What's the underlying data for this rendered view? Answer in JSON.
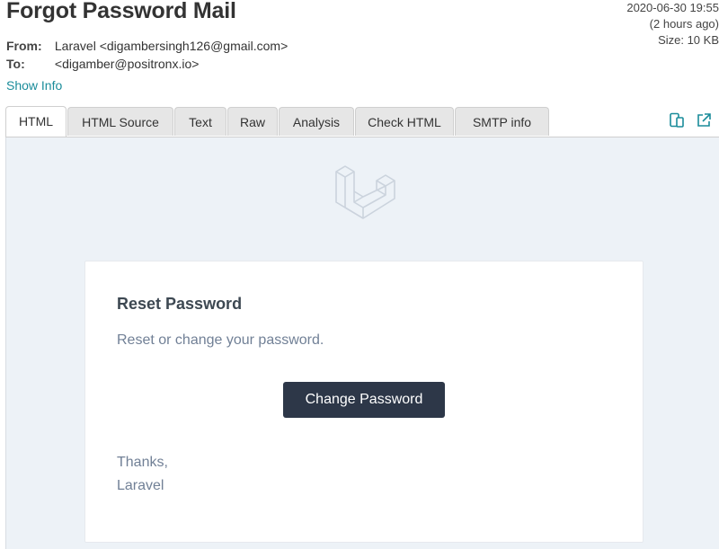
{
  "email": {
    "subject": "Forgot Password Mail",
    "date": "2020-06-30 19:55",
    "relative_time": "(2 hours ago)",
    "size_label": "Size: 10 KB",
    "from_label": "From:",
    "from_value": "Laravel <digambersingh126@gmail.com>",
    "to_label": "To:",
    "to_value": "<digamber@positronx.io>",
    "show_info": "Show Info"
  },
  "tabs": [
    {
      "label": "HTML",
      "active": true
    },
    {
      "label": "HTML Source",
      "active": false
    },
    {
      "label": "Text",
      "active": false
    },
    {
      "label": "Raw",
      "active": false
    },
    {
      "label": "Analysis",
      "active": false
    },
    {
      "label": "Check HTML",
      "active": false
    },
    {
      "label": "SMTP info",
      "active": false
    }
  ],
  "toolbar_icons": [
    "mobile-view-icon",
    "open-external-icon"
  ],
  "message": {
    "title": "Reset Password",
    "body": "Reset or change your password.",
    "button_label": "Change Password",
    "signoff_line1": "Thanks,",
    "signoff_line2": "Laravel"
  },
  "colors": {
    "accent": "#1a8c9a",
    "button_bg": "#2d3748",
    "preview_bg": "#edf2f7"
  }
}
